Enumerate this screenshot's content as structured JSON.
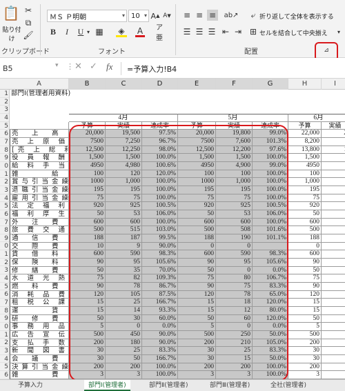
{
  "ribbon": {
    "clipboard": {
      "paste_label": "貼り付け",
      "group_label": "クリップボード"
    },
    "font": {
      "name": "ＭＳ Ｐ明朝",
      "size": "10",
      "group_label": "フォント"
    },
    "alignment": {
      "wrap_label": "折り返して全体を表示する",
      "merge_label": "セルを結合して中央揃え",
      "group_label": "配置"
    }
  },
  "formula_bar": {
    "name_box": "B5",
    "formula": "=予算入力!B4"
  },
  "column_headers": [
    "A",
    "B",
    "C",
    "D",
    "E",
    "F",
    "G",
    "H",
    "I"
  ],
  "row_numbers": [
    "1",
    "2",
    "3",
    "4",
    "5",
    "6",
    "7",
    "8",
    "9",
    "0",
    "1",
    "2",
    "3",
    "4",
    "5",
    "6",
    "7",
    "8",
    "9",
    "0",
    "1",
    "2",
    "3",
    "4",
    "5",
    "6",
    "7",
    "8",
    "9",
    "0",
    "1",
    "2",
    "3",
    "4",
    "5",
    "6"
  ],
  "sheet": {
    "title": "部門Ⅰ(管理者用資料)",
    "months": [
      "4月",
      "5月",
      "6月"
    ],
    "subheaders": [
      "予算",
      "実績",
      "達成率",
      "予算",
      "実績",
      "達成率",
      "予算",
      "実績"
    ],
    "rows": [
      {
        "label": "売　上　高",
        "v": [
          "20,000",
          "19,500",
          "97.5%",
          "20,000",
          "19,800",
          "99.0%",
          "22,000",
          "2"
        ]
      },
      {
        "label": "売 上 原 価",
        "v": [
          "7500",
          "7,250",
          "96.7%",
          "7500",
          "7,600",
          "101.3%",
          "8,200",
          ""
        ]
      },
      {
        "label": "[売 上 総 利 益]",
        "v": [
          "12,500",
          "12,250",
          "98.0%",
          "12,500",
          "12,200",
          "97.6%",
          "13,800",
          "1"
        ]
      },
      {
        "label": "役 員 報 酬",
        "v": [
          "1,500",
          "1,500",
          "100.0%",
          "1,500",
          "1,500",
          "100.0%",
          "1,500",
          ""
        ]
      },
      {
        "label": "給 料 手 当",
        "v": [
          "4950",
          "4,980",
          "100.6%",
          "4950",
          "4,900",
          "99.0%",
          "4950",
          ""
        ]
      },
      {
        "label": "雑　　　給",
        "v": [
          "100",
          "120",
          "120.0%",
          "100",
          "100",
          "100.0%",
          "100",
          ""
        ]
      },
      {
        "label": "賞与引当金繰入",
        "v": [
          "1000",
          "1,000",
          "100.0%",
          "1000",
          "1,000",
          "100.0%",
          "1,000",
          ""
        ]
      },
      {
        "label": "退職引当金繰入",
        "v": [
          "195",
          "195",
          "100.0%",
          "195",
          "195",
          "100.0%",
          "195",
          ""
        ]
      },
      {
        "label": "雇用引当金繰入",
        "v": [
          "75",
          "75",
          "100.0%",
          "75",
          "75",
          "100.0%",
          "75",
          ""
        ]
      },
      {
        "label": "法 定 福 利 費",
        "v": [
          "920",
          "925",
          "100.5%",
          "920",
          "925",
          "100.5%",
          "920",
          ""
        ]
      },
      {
        "label": "福 利 厚 生 費",
        "v": [
          "50",
          "53",
          "106.0%",
          "50",
          "53",
          "106.0%",
          "50",
          ""
        ]
      },
      {
        "label": "外　注　費",
        "v": [
          "600",
          "600",
          "100.0%",
          "600",
          "600",
          "100.0%",
          "600",
          ""
        ]
      },
      {
        "label": "旅 費 交 通 費",
        "v": [
          "500",
          "515",
          "103.0%",
          "500",
          "508",
          "101.6%",
          "500",
          ""
        ]
      },
      {
        "label": "通　信　費",
        "v": [
          "188",
          "187",
          "99.5%",
          "188",
          "190",
          "101.1%",
          "188",
          ""
        ]
      },
      {
        "label": "交　際　費",
        "v": [
          "10",
          "9",
          "90.0%",
          "0",
          "0",
          "",
          "0",
          ""
        ]
      },
      {
        "label": "賃　借　料",
        "v": [
          "600",
          "590",
          "98.3%",
          "600",
          "590",
          "98.3%",
          "600",
          ""
        ]
      },
      {
        "label": "保　険　料",
        "v": [
          "90",
          "95",
          "105.6%",
          "90",
          "95",
          "105.6%",
          "90",
          ""
        ]
      },
      {
        "label": "修　繕　費",
        "v": [
          "50",
          "35",
          "70.0%",
          "50",
          "0",
          "0.0%",
          "50",
          ""
        ]
      },
      {
        "label": "水 道 光 熱 費",
        "v": [
          "75",
          "82",
          "109.3%",
          "75",
          "80",
          "106.7%",
          "75",
          ""
        ]
      },
      {
        "label": "燃　料　費",
        "v": [
          "90",
          "78",
          "86.7%",
          "90",
          "75",
          "83.3%",
          "90",
          ""
        ]
      },
      {
        "label": "消 耗 品 費",
        "v": [
          "120",
          "105",
          "87.5%",
          "120",
          "78",
          "65.0%",
          "120",
          ""
        ]
      },
      {
        "label": "租 税 公 課",
        "v": [
          "15",
          "25",
          "166.7%",
          "15",
          "18",
          "120.0%",
          "15",
          ""
        ]
      },
      {
        "label": "運　　　賃",
        "v": [
          "15",
          "14",
          "93.3%",
          "15",
          "12",
          "80.0%",
          "15",
          ""
        ]
      },
      {
        "label": "研　修　費",
        "v": [
          "50",
          "30",
          "60.0%",
          "50",
          "60",
          "120.0%",
          "50",
          ""
        ]
      },
      {
        "label": "事 務 用 品 費",
        "v": [
          "5",
          "0",
          "0.0%",
          "5",
          "0",
          "0.0%",
          "5",
          ""
        ]
      },
      {
        "label": "広 告 宣 伝 費",
        "v": [
          "500",
          "450",
          "90.0%",
          "500",
          "250",
          "50.0%",
          "500",
          ""
        ]
      },
      {
        "label": "支 払 手 数 料",
        "v": [
          "200",
          "180",
          "90.0%",
          "200",
          "210",
          "105.0%",
          "200",
          ""
        ]
      },
      {
        "label": "新 聞 図 書 費",
        "v": [
          "30",
          "25",
          "83.3%",
          "30",
          "25",
          "83.3%",
          "30",
          ""
        ]
      },
      {
        "label": "会　議　費",
        "v": [
          "30",
          "50",
          "166.7%",
          "30",
          "15",
          "50.0%",
          "30",
          ""
        ]
      },
      {
        "label": "決算引当金繰入",
        "v": [
          "200",
          "200",
          "100.0%",
          "200",
          "200",
          "100.0%",
          "200",
          ""
        ]
      },
      {
        "label": "雑　　　費",
        "v": [
          "3",
          "3",
          "100.0%",
          "3",
          "3",
          "100.0%",
          "3",
          ""
        ]
      },
      {
        "label": "諸 会 費",
        "v": [
          "",
          "",
          "",
          "",
          "",
          "",
          "",
          ""
        ]
      }
    ]
  },
  "tabs": [
    "予算入力",
    "部門Ⅰ(管理者)",
    "部門Ⅱ(管理者)",
    "部門Ⅲ(管理者)",
    "全社(管理者)"
  ],
  "colors": {
    "highlight": "#d8191c",
    "cell_gray": "#c8c8c8"
  }
}
